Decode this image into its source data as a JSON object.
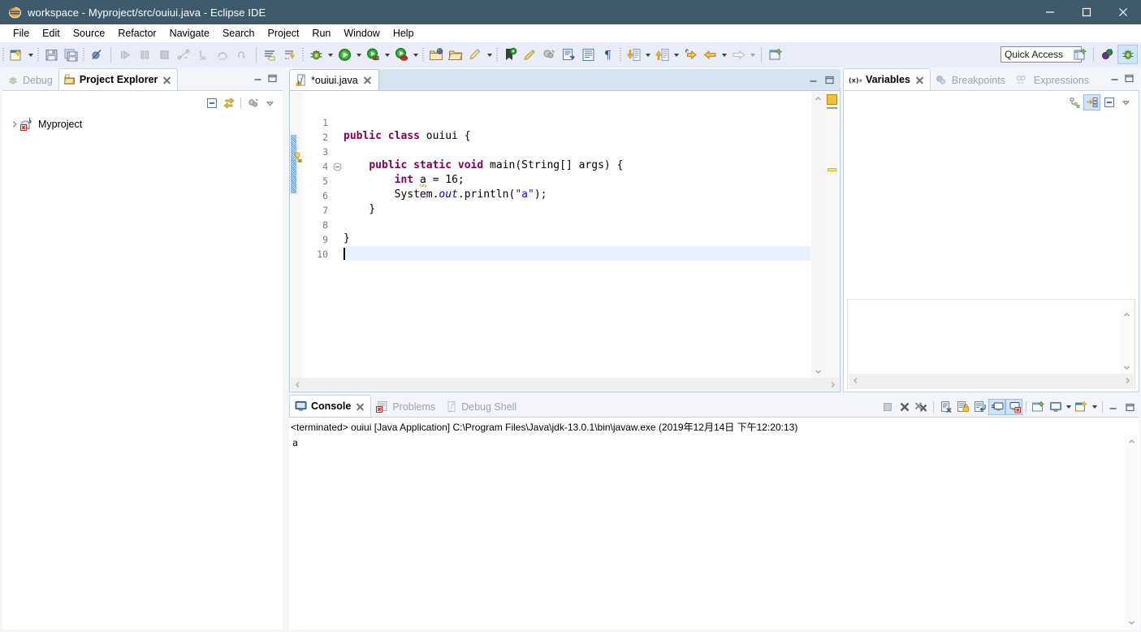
{
  "window": {
    "title": "workspace - Myproject/src/ouiui.java - Eclipse IDE",
    "minimize_label": "Minimize",
    "maximize_label": "Maximize",
    "close_label": "Close"
  },
  "menubar": {
    "items": [
      "File",
      "Edit",
      "Source",
      "Refactor",
      "Navigate",
      "Search",
      "Project",
      "Run",
      "Window",
      "Help"
    ]
  },
  "toolbar": {
    "quick_access_placeholder": "Quick Access",
    "quick_access_value": "",
    "icons": [
      "new-wizard-icon",
      "save-icon",
      "save-all-icon",
      "skip-all-breakpoints-icon",
      "resume-icon",
      "suspend-icon",
      "terminate-icon",
      "disconnect-icon",
      "step-into-icon",
      "step-over-icon",
      "step-return-icon",
      "toggle-step-filters-icon",
      "drop-to-frame-icon",
      "debug-icon",
      "run-icon",
      "external-tools-icon",
      "run-last-tool-icon",
      "new-java-project-icon",
      "open-type-icon",
      "new-annotation-icon",
      "toggle-mark-occurrences-icon",
      "toggle-ant-icon",
      "open-task-icon",
      "search-icon",
      "show-whitespace-icon",
      "pilcrow-icon",
      "next-annotation-icon",
      "previous-annotation-icon",
      "last-edit-location-icon",
      "back-icon",
      "forward-icon",
      "new-window-icon"
    ],
    "perspective": {
      "open_perspective_label": "Open Perspective",
      "java_label": "Java",
      "debug_label": "Debug",
      "active": "Debug"
    }
  },
  "project_explorer": {
    "tabs": [
      {
        "label": "Debug",
        "icon": "debug-perspective-icon",
        "active": false,
        "closable": false
      },
      {
        "label": "Project Explorer",
        "icon": "project-explorer-icon",
        "active": true,
        "closable": true
      }
    ],
    "toolbar_icons": [
      "collapse-all-icon",
      "link-with-editor-icon",
      "focus-on-active-task-icon",
      "view-menu-icon"
    ],
    "tree": [
      {
        "label": "Myproject",
        "icon": "java-project-error-icon",
        "expanded": false,
        "indent": 0
      }
    ]
  },
  "editor": {
    "tab": {
      "label": "*ouiui.java",
      "icon": "java-file-warning-icon",
      "dirty": true,
      "closable": true
    },
    "lines": [
      {
        "n": "1",
        "html": ""
      },
      {
        "n": "2",
        "html": "<span class='kw'>public class</span> ouiui {"
      },
      {
        "n": "3",
        "html": ""
      },
      {
        "n": "4",
        "html": "    <span class='kw'>public static void</span> main(String[] args) {",
        "fold": true
      },
      {
        "n": "5",
        "html": "        <span class='kw'>int</span> <span class='warnvar'>a</span> = 16;",
        "warning": true
      },
      {
        "n": "6",
        "html": "        System.<span class='fld'>out</span>.println(<span class='str'>\"a\"</span>);"
      },
      {
        "n": "7",
        "html": "    }"
      },
      {
        "n": "8",
        "html": ""
      },
      {
        "n": "9",
        "html": "}"
      },
      {
        "n": "10",
        "html": "",
        "current": true,
        "caret": true
      }
    ],
    "plain_text": "\npublic class ouiui {\n\n    public static void main(String[] args) {\n        int a = 16;\n        System.out.println(\"a\");\n    }\n\n}\n",
    "change_bar_lines": [
      4,
      5,
      6,
      7
    ],
    "warning_line": 5,
    "overview_markers": [
      "warning",
      "warning"
    ]
  },
  "variables": {
    "tabs": [
      {
        "label": "Variables",
        "icon": "variables-icon",
        "active": true,
        "closable": true
      },
      {
        "label": "Breakpoints",
        "icon": "breakpoints-icon",
        "active": false,
        "closable": false
      },
      {
        "label": "Expressions",
        "icon": "expressions-icon",
        "active": false,
        "closable": false
      }
    ],
    "toolbar_icons": [
      "show-logical-structure-icon",
      "collapse-all-icon",
      "show-detail-pane-icon",
      "view-menu-icon"
    ],
    "rows": []
  },
  "console": {
    "tabs": [
      {
        "label": "Console",
        "icon": "console-icon",
        "active": true,
        "closable": true
      },
      {
        "label": "Problems",
        "icon": "problems-error-icon",
        "active": false,
        "closable": false
      },
      {
        "label": "Debug Shell",
        "icon": "debug-shell-icon",
        "active": false,
        "closable": false
      }
    ],
    "toolbar_icons": [
      "terminate-icon",
      "remove-launch-icon",
      "remove-all-terminated-icon",
      "clear-console-icon",
      "scroll-lock-icon",
      "word-wrap-icon",
      "show-console-on-output-icon",
      "show-console-on-error-icon",
      "pin-console-icon",
      "display-selected-console-icon",
      "open-console-icon"
    ],
    "header": "<terminated> ouiui [Java Application] C:\\Program Files\\Java\\jdk-13.0.1\\bin\\javaw.exe (2019年12月14日 下午12:20:13)",
    "output": "a"
  },
  "colors": {
    "titlebar_bg": "#3f5a6b",
    "toolbar_bg": "#e9edf9",
    "workbench_bg": "#f3f5fb",
    "active_tab_bg": "#d6e4f2",
    "keyword": "#7f0055",
    "string": "#2a00ff",
    "field": "#0000c0",
    "line_number": "#7a7a7a",
    "current_line": "#e8f2fe",
    "toggled": "#cfe4f7"
  }
}
